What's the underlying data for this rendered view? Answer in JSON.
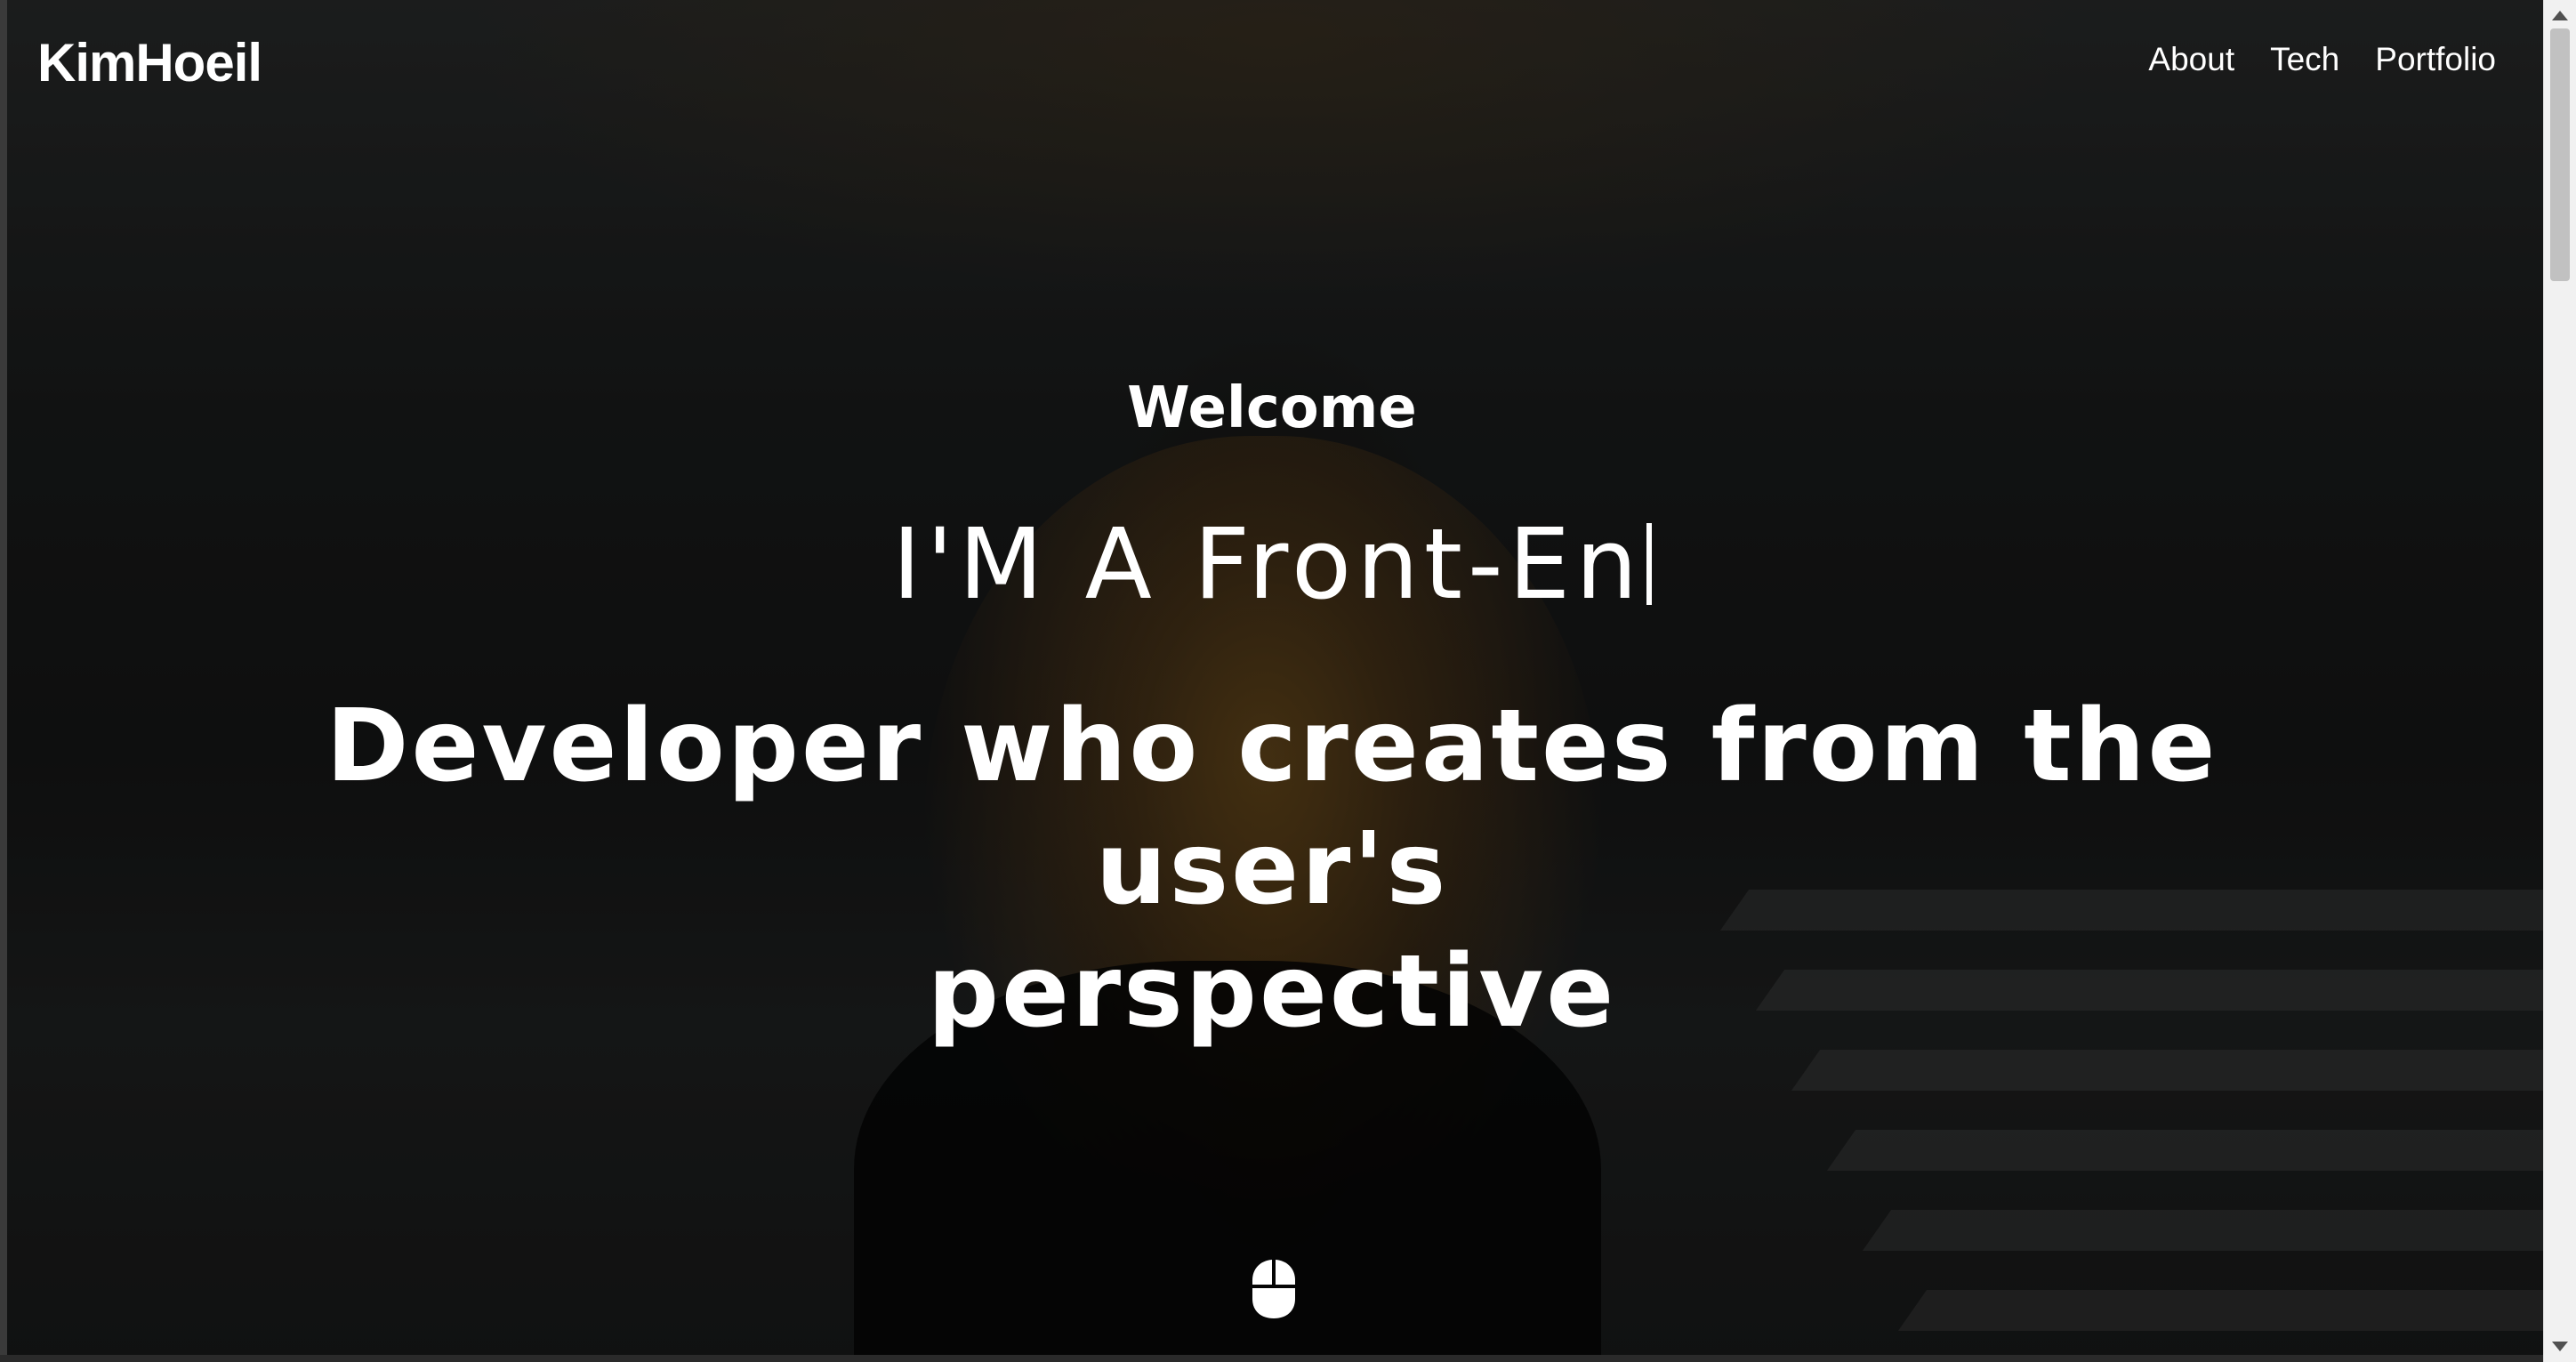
{
  "header": {
    "brand": "KimHoeil",
    "nav": [
      {
        "label": "About"
      },
      {
        "label": "Tech"
      },
      {
        "label": "Portfolio"
      }
    ]
  },
  "hero": {
    "welcome": "Welcome",
    "typed_text": "I'M A Front-En",
    "tagline_line1": "Developer who creates from the user's",
    "tagline_line2": "perspective"
  },
  "icons": {
    "scroll_indicator": "mouse-icon"
  },
  "colors": {
    "text": "#ffffff",
    "background_overlay": "#000000"
  }
}
